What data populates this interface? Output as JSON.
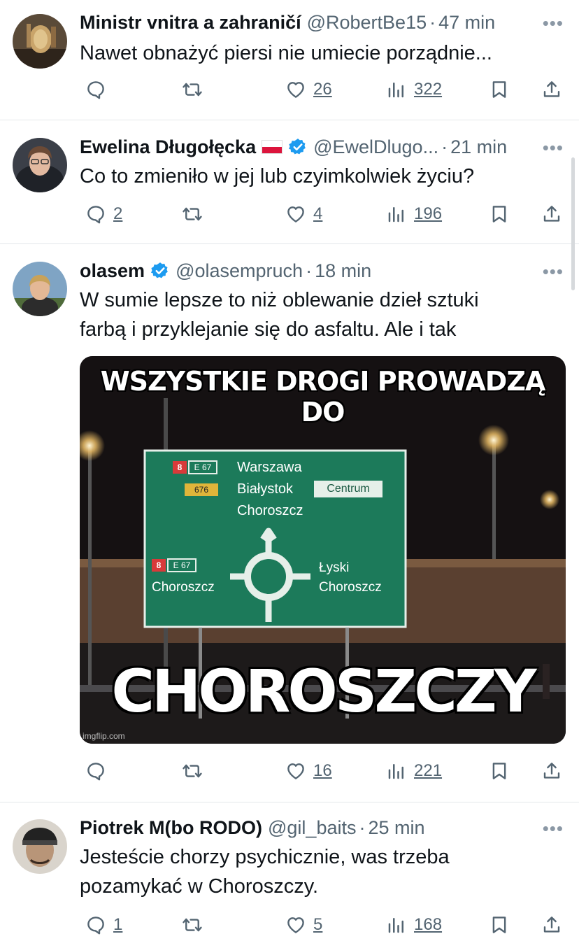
{
  "tweets": [
    {
      "name": "Ministr vnitra a zahraničí",
      "flag": false,
      "verified": false,
      "handle": "@RobertBe15",
      "time": "47 min",
      "text": "Nawet obnażyć piersi nie umiecie porządnie...",
      "replies": "",
      "retweets": "",
      "likes": "26",
      "views": "322"
    },
    {
      "name": "Ewelina Długołęcka",
      "flag": true,
      "verified": true,
      "handle": "@EwelDlugo...",
      "time": "21 min",
      "text": "Co to zmieniło w jej lub czyimkolwiek życiu?",
      "replies": "2",
      "retweets": "",
      "likes": "4",
      "views": "196"
    },
    {
      "name": "olasem",
      "flag": false,
      "verified": true,
      "handle": "@olasempruch",
      "time": "18 min",
      "text_lines": [
        "W sumie lepsze to niż oblewanie dzieł sztuki",
        "farbą i przyklejanie się do asfaltu. Ale i tak"
      ],
      "replies": "",
      "retweets": "",
      "likes": "16",
      "views": "221"
    },
    {
      "name": "Piotrek M(bo RODO)",
      "flag": false,
      "verified": false,
      "handle": "@gil_baits",
      "time": "25 min",
      "text_lines": [
        "Jesteście chorzy psychicznie, was trzeba",
        "pozamykać w Choroszczy."
      ],
      "replies": "1",
      "retweets": "",
      "likes": "5",
      "views": "168"
    }
  ],
  "meme": {
    "top_caption": "WSZYSTKIE DROGI PROWADZĄ DO",
    "bottom_caption": "CHOROSZCZY",
    "watermark": "imgflip.com",
    "sign": {
      "road_8": "8",
      "road_e67": "E 67",
      "road_676": "676",
      "line1": "Warszawa",
      "line2": "Białystok",
      "centrum": "Centrum",
      "line3": "Choroszcz",
      "left_dest": "Choroszcz",
      "right_dest1": "Łyski",
      "right_dest2": "Choroszcz"
    }
  },
  "icons": [
    "reply-icon",
    "retweet-icon",
    "like-icon",
    "views-icon",
    "bookmark-icon",
    "share-icon",
    "verified-badge-icon",
    "more-icon"
  ],
  "colors": {
    "text": "#0f1419",
    "secondary": "#536471",
    "verified": "#1d9bf0",
    "divider": "#e4e7ea",
    "sign_green": "#1c7a5a"
  }
}
